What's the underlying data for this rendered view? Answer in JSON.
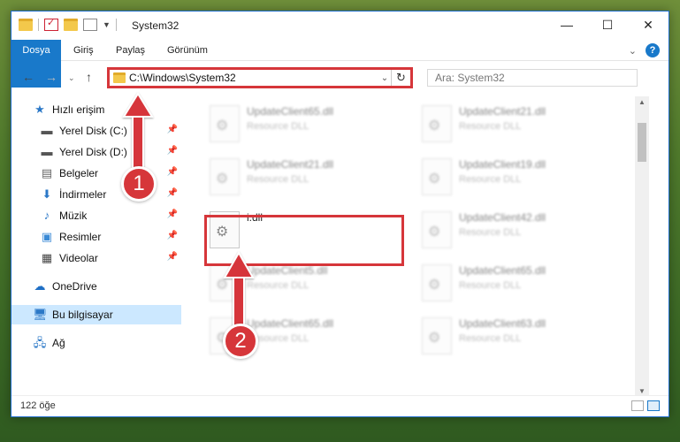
{
  "window": {
    "title": "System32"
  },
  "ribbon": {
    "tabs": [
      "Dosya",
      "Giriş",
      "Paylaş",
      "Görünüm"
    ]
  },
  "nav": {
    "address": "C:\\Windows\\System32",
    "search_placeholder": "Ara: System32"
  },
  "sidebar": {
    "items": [
      {
        "label": "Hızlı erişim",
        "icon": "star-icon",
        "pinned": false
      },
      {
        "label": "Yerel Disk (C:)",
        "icon": "drive-icon",
        "pinned": true
      },
      {
        "label": "Yerel Disk (D:)",
        "icon": "drive-icon",
        "pinned": true
      },
      {
        "label": "Belgeler",
        "icon": "document-icon",
        "pinned": true
      },
      {
        "label": "İndirmeler",
        "icon": "download-icon",
        "pinned": true
      },
      {
        "label": "Müzik",
        "icon": "music-icon",
        "pinned": true
      },
      {
        "label": "Resimler",
        "icon": "pictures-icon",
        "pinned": true
      },
      {
        "label": "Videolar",
        "icon": "video-icon",
        "pinned": true
      },
      {
        "label": "OneDrive",
        "icon": "cloud-icon",
        "pinned": false
      },
      {
        "label": "Bu bilgisayar",
        "icon": "computer-icon",
        "pinned": false
      },
      {
        "label": "Ağ",
        "icon": "network-icon",
        "pinned": false
      }
    ]
  },
  "files": {
    "col1": [
      {
        "name": "UpdateClient65.dll",
        "type": "Resource DLL"
      },
      {
        "name": "UpdateClient21.dll",
        "type": "Resource DLL"
      },
      {
        "name": "i.dll",
        "type": ""
      },
      {
        "name": "UpdateClient5.dll",
        "type": "Resource DLL"
      },
      {
        "name": "UpdateClient65.dll",
        "type": "Resource DLL"
      }
    ],
    "col2": [
      {
        "name": "UpdateClient21.dll",
        "type": "Resource DLL"
      },
      {
        "name": "UpdateClient19.dll",
        "type": "Resource DLL"
      },
      {
        "name": "UpdateClient42.dll",
        "type": "Resource DLL"
      },
      {
        "name": "UpdateClient65.dll",
        "type": "Resource DLL"
      },
      {
        "name": "UpdateClient63.dll",
        "type": "Resource DLL"
      }
    ]
  },
  "status": {
    "count": "122 öğe"
  },
  "annotations": {
    "step1": "1",
    "step2": "2"
  },
  "colors": {
    "accent": "#1979ca",
    "highlight": "#d6363a"
  }
}
